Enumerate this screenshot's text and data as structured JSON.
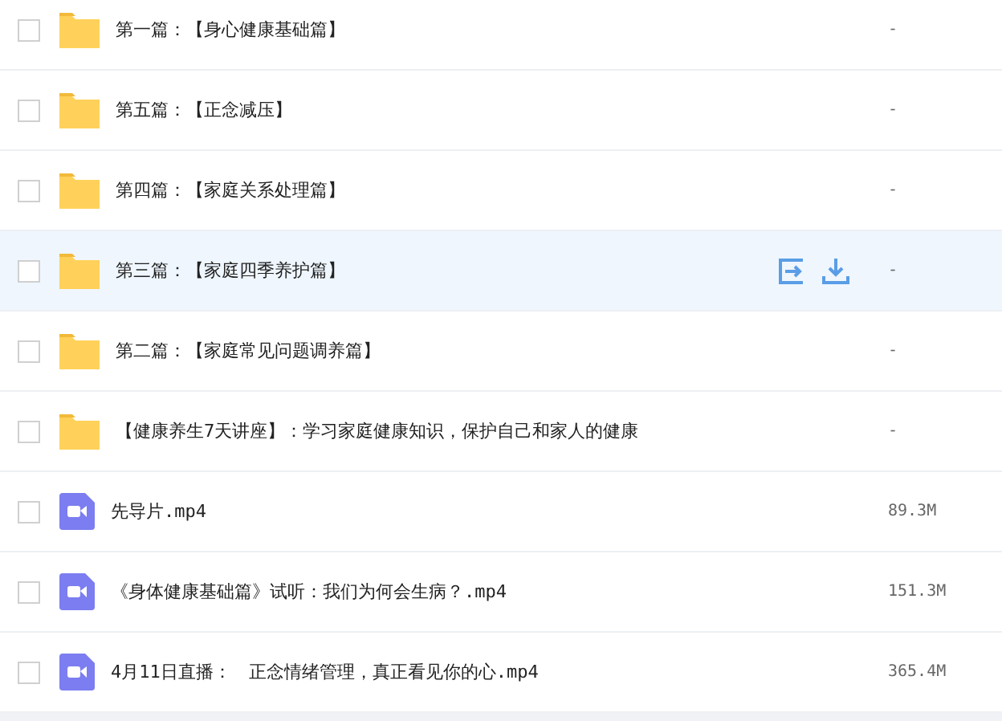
{
  "files": [
    {
      "kind": "folder",
      "name": "第一篇：【身心健康基础篇】",
      "size": "-",
      "checked": false,
      "hovered": false
    },
    {
      "kind": "folder",
      "name": "第五篇：【正念减压】",
      "size": "-",
      "checked": false,
      "hovered": false
    },
    {
      "kind": "folder",
      "name": "第四篇：【家庭关系处理篇】",
      "size": "-",
      "checked": false,
      "hovered": false
    },
    {
      "kind": "folder",
      "name": "第三篇：【家庭四季养护篇】",
      "size": "-",
      "checked": false,
      "hovered": true
    },
    {
      "kind": "folder",
      "name": "第二篇：【家庭常见问题调养篇】",
      "size": "-",
      "checked": false,
      "hovered": false
    },
    {
      "kind": "folder",
      "name": "【健康养生7天讲座】：学习家庭健康知识，保护自己和家人的健康",
      "size": "-",
      "checked": false,
      "hovered": false
    },
    {
      "kind": "video",
      "name": "先导片.mp4",
      "size": "89.3M",
      "checked": false,
      "hovered": false
    },
    {
      "kind": "video",
      "name": "《身体健康基础篇》试听：我们为何会生病？.mp4",
      "size": "151.3M",
      "checked": false,
      "hovered": false
    },
    {
      "kind": "video",
      "name": "4月11日直播：　正念情绪管理，真正看见你的心.mp4",
      "size": "365.4M",
      "checked": false,
      "hovered": false
    }
  ]
}
